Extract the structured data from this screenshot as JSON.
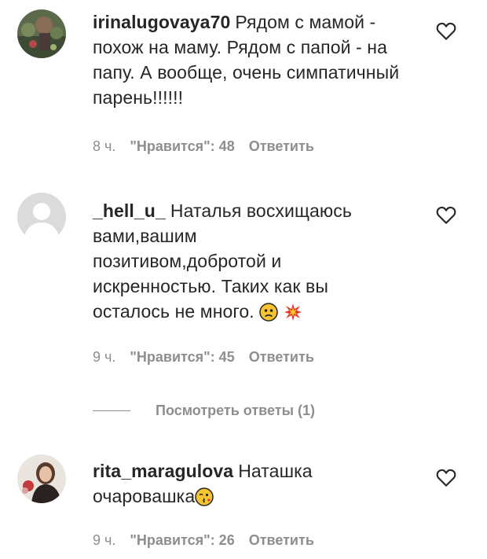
{
  "comments": [
    {
      "username": "irinalugovaya70",
      "text": "Рядом с мамой - похож на маму. Рядом с папой - на папу. А вообще, очень симпатичный парень!!!!!!",
      "time": "8 ч.",
      "likes": "\"Нравится\": 48",
      "reply": "Ответить",
      "emojis": []
    },
    {
      "username": "_hell_u_",
      "text": "Наталья восхищаюсь вами,вашим позитивом,добротой и искренностью. Таких как вы осталось не много.",
      "time": "9 ч.",
      "likes": "\"Нравится\": 45",
      "reply": "Ответить",
      "emojis": [
        "worried-face-emoji",
        "collision-emoji"
      ]
    },
    {
      "username": "rita_maragulova",
      "text": "Наташка очаровашка",
      "time": "9 ч.",
      "likes": "\"Нравится\": 26",
      "reply": "Ответить",
      "emojis": [
        "face-blowing-kiss-emoji"
      ]
    }
  ],
  "view_replies": {
    "label": "Посмотреть ответы (1)"
  },
  "icons": {
    "like": "heart-outline-icon"
  },
  "colors": {
    "text": "#262626",
    "meta": "#8e8e8e"
  }
}
